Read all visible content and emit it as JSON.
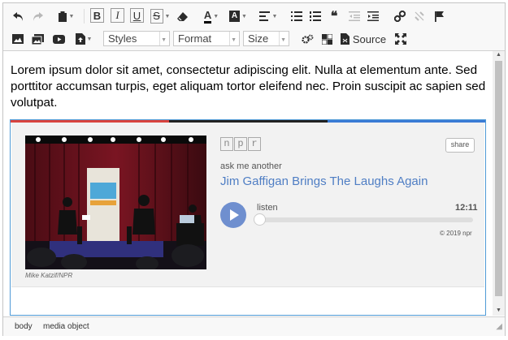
{
  "toolbar": {
    "row1": [
      "undo-icon",
      "redo-icon",
      "paste-icon",
      "bold",
      "italic",
      "underline",
      "strikethrough",
      "eraser-icon",
      "text-color",
      "bg-color",
      "align",
      "bulleted-list",
      "numbered-list",
      "blockquote",
      "outdent",
      "indent",
      "link",
      "unlink",
      "anchor"
    ],
    "bold_label": "B",
    "italic_label": "I",
    "underline_label": "U",
    "strike_label": "S",
    "text_color_label": "A",
    "bg_color_label": "A",
    "styles_label": "Styles",
    "format_label": "Format",
    "size_label": "Size",
    "source_label": "Source"
  },
  "content": {
    "paragraph": "Lorem ipsum dolor sit amet, consectetur adipiscing elit. Nulla at elementum ante. Sed porttitor accumsan turpis, eget aliquam tortor eleifend nec. Proin suscipit ac sapien sed volutpat.",
    "embed": {
      "npr_letters": [
        "n",
        "p",
        "r"
      ],
      "share_label": "share",
      "program": "ask me another",
      "story_title": "Jim Gaffigan Brings The Laughs Again",
      "listen_label": "listen",
      "duration": "12:11",
      "copyright": "© 2019 npr",
      "photo_credit": "Mike Katzif/NPR",
      "progress": 0,
      "bar_colors": [
        "#d9443f",
        "#222222",
        "#3a7bd5"
      ]
    }
  },
  "statusbar": {
    "path": [
      "body",
      "media object"
    ]
  },
  "colors": {
    "accent": "#4f7ec4",
    "play_button": "#6f8fcf",
    "focus_border": "#4f9ad6"
  }
}
